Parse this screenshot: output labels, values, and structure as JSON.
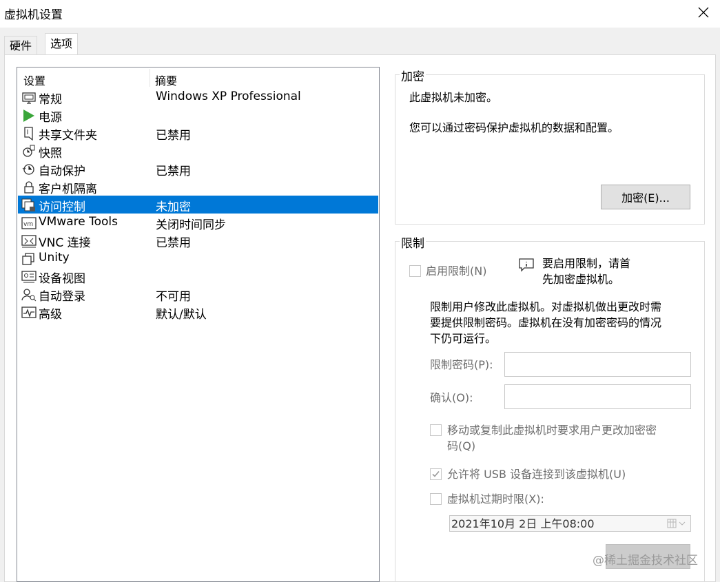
{
  "window": {
    "title": "虚拟机设置"
  },
  "tabs": [
    {
      "label": "硬件",
      "active": false
    },
    {
      "label": "选项",
      "active": true
    }
  ],
  "list": {
    "headers": {
      "setting": "设置",
      "summary": "摘要"
    },
    "rows": [
      {
        "icon": "monitor-icon",
        "label": "常规",
        "summary": "Windows XP Professional"
      },
      {
        "icon": "power-play-icon",
        "label": "电源",
        "summary": ""
      },
      {
        "icon": "shared-folder-icon",
        "label": "共享文件夹",
        "summary": "已禁用"
      },
      {
        "icon": "snapshot-icon",
        "label": "快照",
        "summary": ""
      },
      {
        "icon": "clock-icon",
        "label": "自动保护",
        "summary": "已禁用"
      },
      {
        "icon": "lock-icon",
        "label": "客户机隔离",
        "summary": ""
      },
      {
        "icon": "access-control-icon",
        "label": "访问控制",
        "summary": "未加密",
        "selected": true
      },
      {
        "icon": "vm-icon",
        "label": "VMware Tools",
        "summary": "关闭时间同步"
      },
      {
        "icon": "vnc-icon",
        "label": "VNC 连接",
        "summary": "已禁用"
      },
      {
        "icon": "unity-icon",
        "label": "Unity",
        "summary": ""
      },
      {
        "icon": "device-view-icon",
        "label": "设备视图",
        "summary": ""
      },
      {
        "icon": "auto-login-icon",
        "label": "自动登录",
        "summary": "不可用"
      },
      {
        "icon": "advanced-icon",
        "label": "高级",
        "summary": "默认/默认"
      }
    ]
  },
  "encryption": {
    "title": "加密",
    "status": "此虚拟机未加密。",
    "description": "您可以通过密码保护虚拟机的数据和配置。",
    "button": "加密(E)..."
  },
  "restrictions": {
    "title": "限制",
    "enable_label": "启用限制(N)",
    "info_line1": "要启用限制，请首",
    "info_line2": "先加密虚拟机。",
    "desc_line1": "限制用户修改此虚拟机。对虚拟机做出更改时需",
    "desc_line2": "要提供限制密码。虚拟机在没有加密密码的情况",
    "desc_line3": "下仍可运行。",
    "password_label": "限制密码(P):",
    "confirm_label": "确认(O):",
    "move_copy_line1": "移动或复制此虚拟机时要求用户更改加密密",
    "move_copy_line2": "码(Q)",
    "usb_label": "允许将 USB 设备连接到该虚拟机(U)",
    "usb_checked": true,
    "expire_label": "虚拟机过期时限(X):",
    "expire_date": "2021年10月  2日  上午08:00"
  },
  "watermark": "@稀土掘金技术社区"
}
